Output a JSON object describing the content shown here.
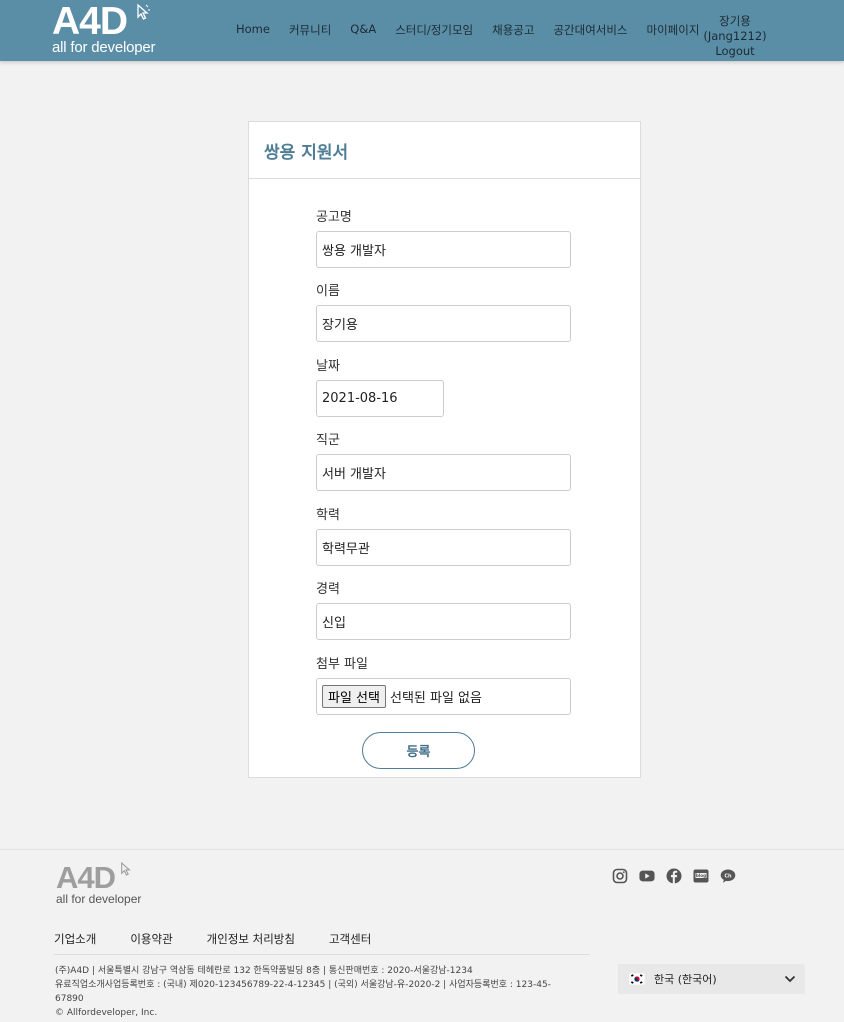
{
  "header": {
    "logo_text": "A4D",
    "logo_sub": "all for developer",
    "nav": [
      "Home",
      "커뮤니티",
      "Q&A",
      "스터디/정기모임",
      "채용공고",
      "공간대여서비스",
      "마이페이지"
    ],
    "user_name": "장기용(Jang1212)",
    "logout": "Logout",
    "brand_color": "#5a8ea7"
  },
  "form": {
    "title": "쌍용 지원서",
    "fields": [
      {
        "label": "공고명",
        "value": "쌍용 개발자"
      },
      {
        "label": "이름",
        "value": "장기용"
      },
      {
        "label": "날짜",
        "value": "2021-08-16"
      },
      {
        "label": "직군",
        "value": "서버 개발자"
      },
      {
        "label": "학력",
        "value": "학력무관"
      },
      {
        "label": "경력",
        "value": "신입"
      }
    ],
    "file_label": "첨부 파일",
    "file_button": "파일 선택",
    "file_status": "선택된 파일 없음",
    "submit": "등록"
  },
  "footer": {
    "logo_text": "A4D",
    "logo_sub": "all for developer",
    "social_icons": [
      "instagram-icon",
      "youtube-icon",
      "facebook-icon",
      "blog-icon",
      "kakao-channel-icon"
    ],
    "links": [
      "기업소개",
      "이용약관",
      "개인정보 처리방침",
      "고객센터"
    ],
    "info": [
      "(주)A4D | 서울특별시 강남구 역삼동 테헤란로 132 한독약품빌딩 8층 | 통신판매번호 : 2020-서울강남-1234",
      "유료직업소개사업등록번호 : (국내) 제020-123456789-22-4-12345 | (국외) 서울강남-유-2020-2 | 사업자등록번호 : 123-45-67890",
      "© Allfordeveloper, Inc."
    ],
    "language": "한국 (한국어)"
  }
}
